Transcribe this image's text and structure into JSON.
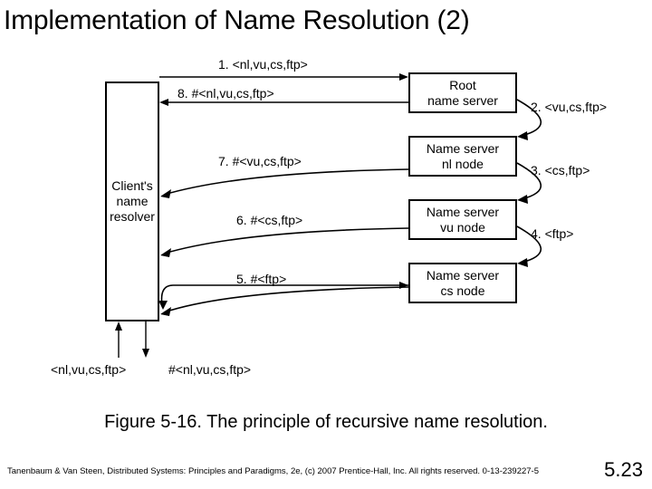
{
  "title": "Implementation of Name Resolution (2)",
  "boxes": {
    "client": "Client's\nname\nresolver",
    "root": "Root\nname server",
    "nl": "Name server\nnl node",
    "vu": "Name server\nvu node",
    "cs": "Name server\ncs node"
  },
  "edges": {
    "e1": "1. <nl,vu,cs,ftp>",
    "e2": "2. <vu,cs,ftp>",
    "e3": "3. <cs,ftp>",
    "e4": "4. <ftp>",
    "e5": "5. #<ftp>",
    "e6": "6. #<cs,ftp>",
    "e7": "7. #<vu,cs,ftp>",
    "e8": "8. #<nl,vu,cs,ftp>"
  },
  "bottom_labels": {
    "in": "<nl,vu,cs,ftp>",
    "out": "#<nl,vu,cs,ftp>"
  },
  "caption": "Figure 5-16. The principle of recursive name resolution.",
  "footer": "Tanenbaum & Van Steen, Distributed Systems: Principles and Paradigms, 2e, (c) 2007 Prentice-Hall, Inc. All rights reserved. 0-13-239227-5",
  "pagenum": "5.23"
}
